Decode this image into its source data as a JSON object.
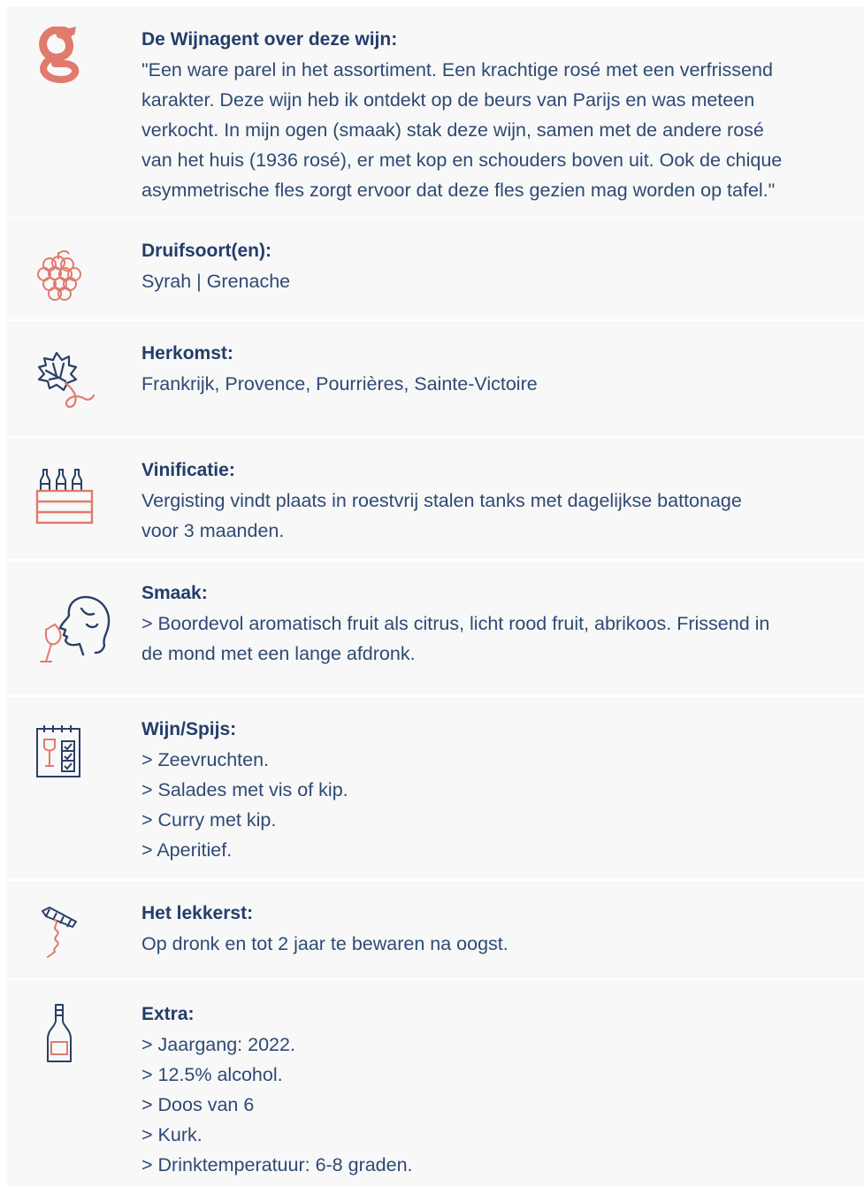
{
  "colors": {
    "accent": "#e07b6d",
    "navy": "#2a3f66",
    "row_background": "#f8f8f8",
    "divider": "#ffffff"
  },
  "rows": [
    {
      "icon": "wijnagent-logo-icon",
      "title": "De Wijnagent over deze wijn:",
      "lines": [
        "\"Een ware parel in het assortiment. Een krachtige rosé met een verfrissend",
        "karakter. Deze wijn heb ik ontdekt op de beurs van Parijs en was meteen",
        "verkocht. In mijn ogen (smaak) stak deze wijn, samen met de andere rosé",
        "van het huis (1936 rosé), er met kop en schouders boven uit. Ook de chique",
        "asymmetrische fles zorgt ervoor dat deze fles gezien mag worden op tafel.\""
      ]
    },
    {
      "icon": "grapes-icon",
      "title": "Druifsoort(en):",
      "lines": [
        "Syrah | Grenache"
      ]
    },
    {
      "icon": "vine-leaf-icon",
      "title": "Herkomst:",
      "lines": [
        "Frankrijk, Provence, Pourrières, Sainte-Victoire"
      ]
    },
    {
      "icon": "wine-crate-icon",
      "title": "Vinificatie:",
      "lines": [
        "Vergisting vindt plaats in roestvrij stalen tanks met dagelijkse battonage",
        "voor 3 maanden."
      ]
    },
    {
      "icon": "tasting-head-icon",
      "title": "Smaak:",
      "lines": [
        "> Boordevol aromatisch fruit als citrus, licht rood fruit, abrikoos. Frissend in",
        "de mond met een lange afdronk."
      ]
    },
    {
      "icon": "menu-card-icon",
      "title": "Wijn/Spijs:",
      "lines": [
        "> Zeevruchten.",
        "> Salades met vis of kip.",
        "> Curry met kip.",
        "> Aperitief."
      ]
    },
    {
      "icon": "corkscrew-icon",
      "title": "Het lekkerst:",
      "lines": [
        "Op dronk en tot 2 jaar te bewaren na oogst."
      ]
    },
    {
      "icon": "wine-bottle-icon",
      "title": "Extra:",
      "lines": [
        "> Jaargang: 2022.",
        "> 12.5% alcohol.",
        "> Doos van 6",
        "> Kurk.",
        "> Drinktemperatuur: 6-8 graden."
      ]
    }
  ]
}
